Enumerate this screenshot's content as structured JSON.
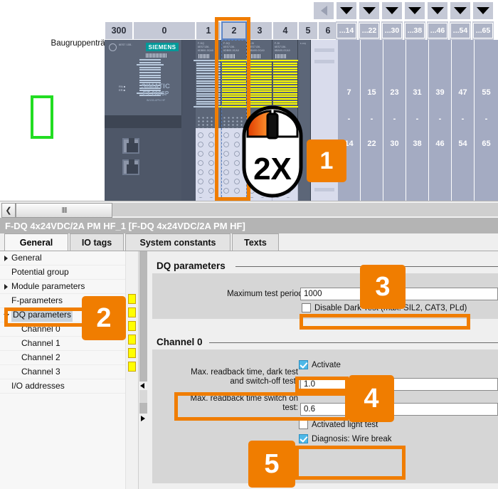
{
  "rack": {
    "label": "Baugruppenträge...",
    "slot_headers": [
      "300",
      "0",
      "1",
      "2",
      "3",
      "4",
      "5",
      "6"
    ],
    "selected_slot": "2",
    "address_chips": [
      "...14",
      "...22",
      "...30",
      "...38",
      "...46",
      "...54",
      "...65"
    ],
    "address_rows": [
      [
        "7",
        "15",
        "23",
        "31",
        "39",
        "47",
        "55"
      ],
      [
        "-",
        "-",
        "-",
        "-",
        "-",
        "-",
        "-"
      ],
      [
        "14",
        "22",
        "30",
        "38",
        "46",
        "54",
        "65"
      ]
    ],
    "cpu": {
      "brand": "SIEMENS",
      "line1": "SIMATIC",
      "line2": "ET 200SP",
      "line3": "IM155-6PN HF",
      "tiny_left": "6ES7 155-",
      "tiny_cap": "IM 155-6PN HF"
    },
    "module_captions": [
      {
        "top": "F-DQ",
        "sub": "6ES7136-6DB00-0CA0"
      },
      {
        "top": "F-DQ",
        "sub": "6ES7136-6DB00-0CA0"
      },
      {
        "top": "F-DI",
        "sub": "6ES7136-6BA00-0CA0"
      },
      {
        "top": "F-DI",
        "sub": "6ES7136-6BA00-0CA0"
      },
      {
        "top": "F-DQ",
        "sub": "Srv 2x24Vx/0.5a"
      }
    ],
    "icons": {
      "collapse": "triangle-left-icon",
      "dropdown": "triangle-down-icon",
      "double_click": "mouse-double-click-icon",
      "double_click_label": "2X"
    }
  },
  "hscroll": {
    "back_label": "❮",
    "grip_label": "‖‖"
  },
  "inspector": {
    "title": "F-DQ 4x24VDC/2A PM HF_1 [F-DQ 4x24VDC/2A PM HF]",
    "tabs": [
      {
        "label": "General",
        "active": true
      },
      {
        "label": "IO tags",
        "active": false
      },
      {
        "label": "System constants",
        "active": false
      },
      {
        "label": "Texts",
        "active": false
      }
    ],
    "tree": [
      {
        "label": "General",
        "expandable": true,
        "expanded": false,
        "indent": 16,
        "selected": false,
        "marker": false
      },
      {
        "label": "Potential group",
        "expandable": false,
        "expanded": false,
        "indent": 16,
        "selected": false,
        "marker": false
      },
      {
        "label": "Module parameters",
        "expandable": true,
        "expanded": false,
        "indent": 16,
        "selected": false,
        "marker": false
      },
      {
        "label": "F-parameters",
        "expandable": false,
        "expanded": false,
        "indent": 16,
        "selected": false,
        "marker": true
      },
      {
        "label": "DQ parameters",
        "expandable": true,
        "expanded": true,
        "indent": 16,
        "selected": true,
        "marker": true
      },
      {
        "label": "Channel 0",
        "expandable": false,
        "expanded": false,
        "indent": 30,
        "selected": false,
        "marker": true
      },
      {
        "label": "Channel 1",
        "expandable": false,
        "expanded": false,
        "indent": 30,
        "selected": false,
        "marker": true
      },
      {
        "label": "Channel 2",
        "expandable": false,
        "expanded": false,
        "indent": 30,
        "selected": false,
        "marker": true
      },
      {
        "label": "Channel 3",
        "expandable": false,
        "expanded": false,
        "indent": 30,
        "selected": false,
        "marker": true
      },
      {
        "label": "I/O addresses",
        "expandable": false,
        "expanded": false,
        "indent": 16,
        "selected": false,
        "marker": false
      }
    ],
    "sections": {
      "dq": {
        "title": "DQ parameters",
        "max_test_period_label": "Maximum test period:",
        "max_test_period_value": "1000",
        "disable_dark_test_label": "Disable Dark Test (max. SIL2, CAT3, PLd)",
        "disable_dark_test_checked": false
      },
      "ch0": {
        "title": "Channel 0",
        "activate_label": "Activate",
        "activate_checked": true,
        "readback_dark_label_l1": "Max. readback time, dark test",
        "readback_dark_label_l2": "and switch-off test:",
        "readback_dark_value": "1.0",
        "readback_on_label_l1": "Max. readback time switch on",
        "readback_on_label_l2": "test:",
        "readback_on_value": "0.6",
        "light_test_label": "Activated light test",
        "light_test_checked": false,
        "wire_break_label": "Diagnosis: Wire break",
        "wire_break_checked": true
      }
    }
  },
  "annotations": {
    "accent": "#f07d00",
    "green": "#22dd22",
    "steps": [
      "1",
      "2",
      "3",
      "4",
      "5"
    ]
  }
}
